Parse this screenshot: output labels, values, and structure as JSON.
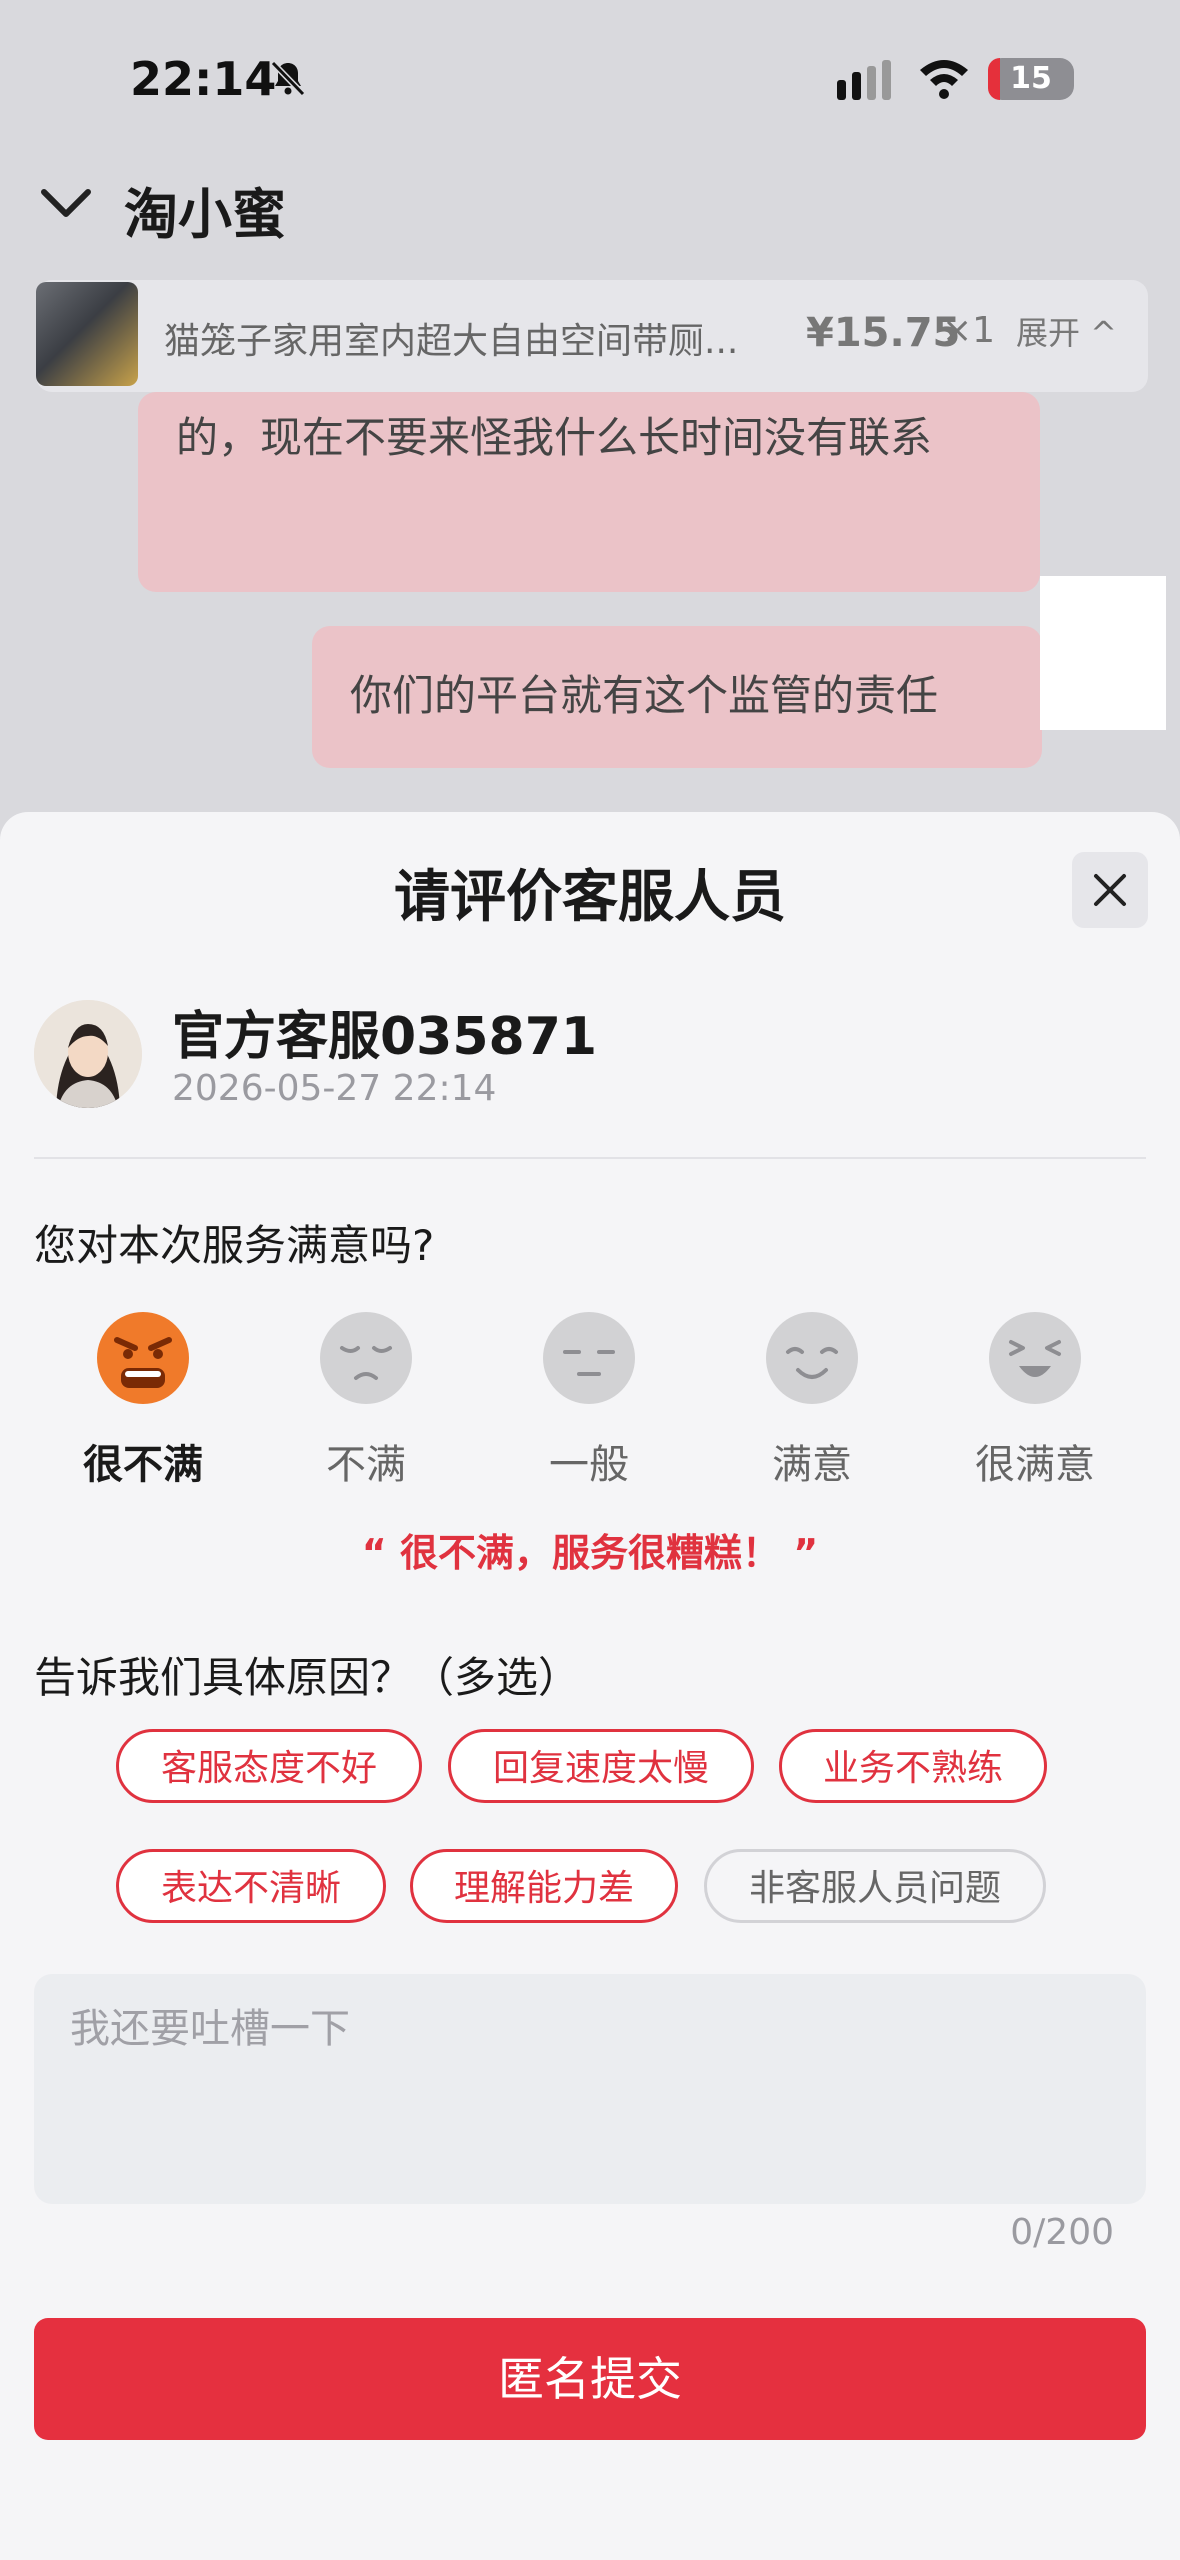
{
  "status_bar": {
    "time": "22:14",
    "battery_level": "15"
  },
  "chat": {
    "title": "淘小蜜",
    "product": {
      "name": "猫笼子家用室内超大自由空间带厕...",
      "price": "¥15.75",
      "quantity": "×1",
      "expand_label": "展开 ^"
    },
    "messages": [
      "的，现在不要来怪我什么长时间没有联系",
      "你们的平台就有这个监管的责任"
    ]
  },
  "sheet": {
    "title": "请评价客服人员",
    "agent": {
      "name": "官方客服035871",
      "time": "2026-05-27 22:14"
    },
    "question_satisfaction": "您对本次服务满意吗?",
    "ratings": [
      {
        "label": "很不满",
        "icon": "angry-face-icon",
        "selected": true
      },
      {
        "label": "不满",
        "icon": "unhappy-face-icon",
        "selected": false
      },
      {
        "label": "一般",
        "icon": "neutral-face-icon",
        "selected": false
      },
      {
        "label": "满意",
        "icon": "smile-face-icon",
        "selected": false
      },
      {
        "label": "很满意",
        "icon": "laugh-face-icon",
        "selected": false
      }
    ],
    "feedback_quote": "“ 很不满，服务很糟糕！ ”",
    "question_reasons": "告诉我们具体原因？（多选）",
    "reasons": [
      {
        "label": "客服态度不好",
        "active": true
      },
      {
        "label": "回复速度太慢",
        "active": true
      },
      {
        "label": "业务不熟练",
        "active": true
      },
      {
        "label": "表达不清晰",
        "active": true
      },
      {
        "label": "理解能力差",
        "active": true
      },
      {
        "label": "非客服人员问题",
        "active": false
      }
    ],
    "comment": {
      "placeholder": "我还要吐槽一下",
      "value": "",
      "counter": "0/200"
    },
    "submit_label": "匿名提交"
  },
  "colors": {
    "accent": "#e5303f",
    "accent_text": "#e0323f",
    "angry_face": "#f07a2a",
    "inactive_face": "#d2d2d4"
  }
}
